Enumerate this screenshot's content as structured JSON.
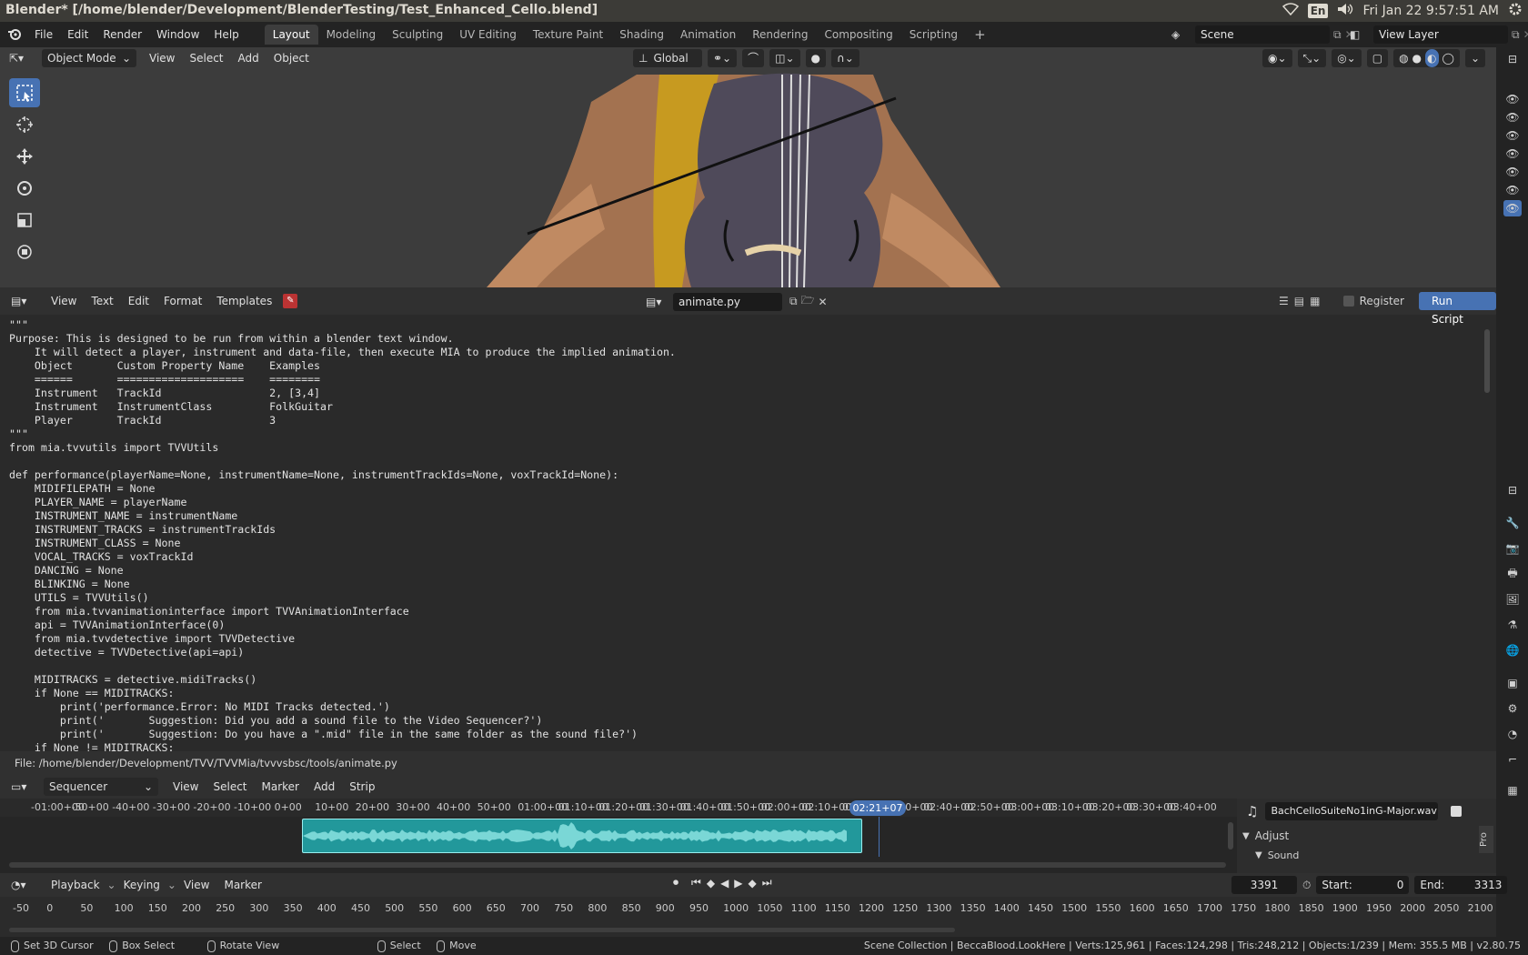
{
  "os": {
    "window_title": "Blender* [/home/blender/Development/BlenderTesting/Test_Enhanced_Cello.blend]",
    "lang": "En",
    "clock": "Fri Jan 22  9:57:51 AM"
  },
  "topbar": {
    "menus": [
      "File",
      "Edit",
      "Render",
      "Window",
      "Help"
    ],
    "workspaces": [
      "Layout",
      "Modeling",
      "Sculpting",
      "UV Editing",
      "Texture Paint",
      "Shading",
      "Animation",
      "Rendering",
      "Compositing",
      "Scripting"
    ],
    "active_workspace": "Layout",
    "scene": "Scene",
    "view_layer": "View Layer"
  },
  "viewport": {
    "mode": "Object Mode",
    "menus": [
      "View",
      "Select",
      "Add",
      "Object"
    ],
    "orientation": "Global"
  },
  "text_editor": {
    "menus": [
      "View",
      "Text",
      "Edit",
      "Format",
      "Templates"
    ],
    "filename": "animate.py",
    "register_label": "Register",
    "run_label": "Run Script",
    "footer_path": "File: /home/blender/Development/TVV/TVVMia/tvvvsbsc/tools/animate.py",
    "code": "\"\"\"\nPurpose: This is designed to be run from within a blender text window.\n    It will detect a player, instrument and data-file, then execute MIA to produce the implied animation.\n    Object       Custom Property Name    Examples\n    ======       ====================    ========\n    Instrument   TrackId                 2, [3,4]\n    Instrument   InstrumentClass         FolkGuitar\n    Player       TrackId                 3\n\"\"\"\nfrom mia.tvvutils import TVVUtils\n\ndef performance(playerName=None, instrumentName=None, instrumentTrackIds=None, voxTrackId=None):\n    MIDIFILEPATH = None\n    PLAYER_NAME = playerName\n    INSTRUMENT_NAME = instrumentName\n    INSTRUMENT_TRACKS = instrumentTrackIds\n    INSTRUMENT_CLASS = None\n    VOCAL_TRACKS = voxTrackId\n    DANCING = None\n    BLINKING = None\n    UTILS = TVVUtils()\n    from mia.tvvanimationinterface import TVVAnimationInterface\n    api = TVVAnimationInterface(0)\n    from mia.tvvdetective import TVVDetective\n    detective = TVVDetective(api=api)\n\n    MIDITRACKS = detective.midiTracks()\n    if None == MIDITRACKS:\n        print('performance.Error: No MIDI Tracks detected.')\n        print('       Suggestion: Did you add a sound file to the Video Sequencer?')\n        print('       Suggestion: Do you have a \".mid\" file in the same folder as the sound file?')\n    if None != MIDITRACKS:"
  },
  "sequencer": {
    "editor": "Sequencer",
    "menus": [
      "View",
      "Select",
      "Marker",
      "Add",
      "Strip"
    ],
    "ruler": [
      "-01:00+00",
      "-50+00",
      "-40+00",
      "-30+00",
      "-20+00",
      "-10+00",
      "0+00",
      "10+00",
      "20+00",
      "30+00",
      "40+00",
      "50+00",
      "01:00+00",
      "01:10+00",
      "01:20+00",
      "01:30+00",
      "01:40+00",
      "01:50+00",
      "02:00+00",
      "02:10+00",
      "02:20+00",
      "02:30+00",
      "02:40+00",
      "02:50+00",
      "03:00+00",
      "03:10+00",
      "03:20+00",
      "03:30+00",
      "03:40+00"
    ],
    "playhead": "02:21+07",
    "strip_name": "BachCelloSuiteNo1inG-Major.wav",
    "adjust_label": "Adjust",
    "sound_label": "Sound",
    "tab_label": "Pro"
  },
  "timeline": {
    "menus": [
      "Playback",
      "Keying",
      "View",
      "Marker"
    ],
    "current_frame": "3391",
    "start_label": "Start:",
    "start": "0",
    "end_label": "End:",
    "end": "3313",
    "ruler": [
      "-50",
      "0",
      "50",
      "100",
      "150",
      "200",
      "250",
      "300",
      "350",
      "400",
      "450",
      "500",
      "550",
      "600",
      "650",
      "700",
      "750",
      "800",
      "850",
      "900",
      "950",
      "1000",
      "1050",
      "1100",
      "1150",
      "1200",
      "1250",
      "1300",
      "1350",
      "1400",
      "1450",
      "1500",
      "1550",
      "1600",
      "1650",
      "1700",
      "1750",
      "1800",
      "1850",
      "1900",
      "1950",
      "2000",
      "2050",
      "2100"
    ]
  },
  "statusbar": {
    "items": [
      "Set 3D Cursor",
      "Box Select",
      "Rotate View",
      "Select",
      "Move"
    ],
    "stats": "Scene Collection | BeccaBlood.LookHere | Verts:125,961 | Faces:124,298 | Tris:248,212 | Objects:1/239 | Mem: 355.5 MB | v2.80.75"
  },
  "colors": {
    "accent": "#4772b3",
    "strip": "#22989b",
    "playhead": "#4772b3"
  }
}
